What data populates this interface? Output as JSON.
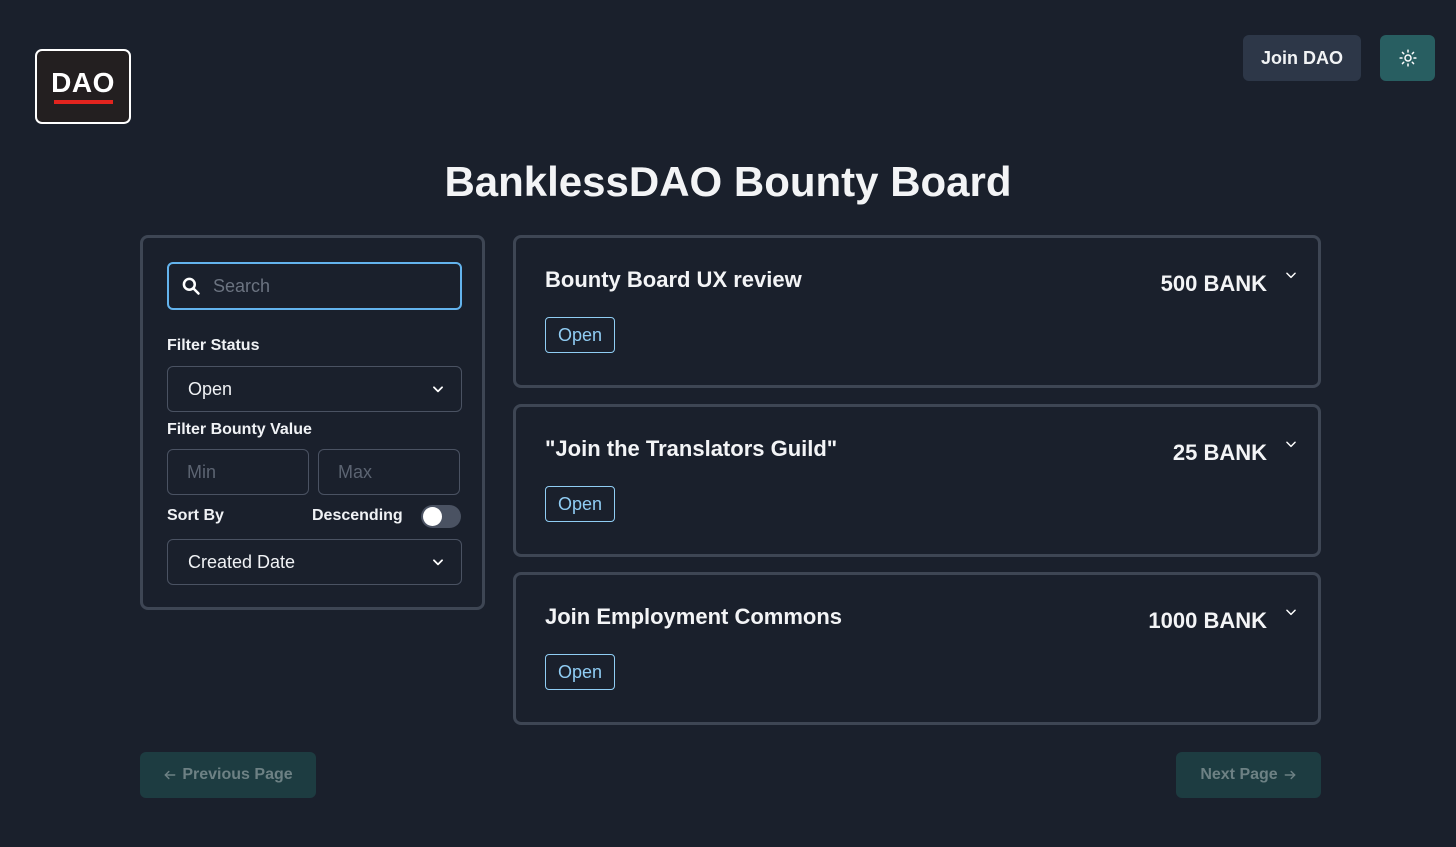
{
  "logo": {
    "text": "DAO"
  },
  "header": {
    "join_label": "Join DAO",
    "theme_toggle_icon": "sun-icon"
  },
  "page": {
    "title": "BanklessDAO Bounty Board"
  },
  "filters": {
    "search_placeholder": "Search",
    "status_label": "Filter Status",
    "status_value": "Open",
    "value_label": "Filter Bounty Value",
    "min_placeholder": "Min",
    "max_placeholder": "Max",
    "sort_label": "Sort By",
    "descending_label": "Descending",
    "descending_on": false,
    "sort_value": "Created Date"
  },
  "bounties": [
    {
      "title": "Bounty Board UX review",
      "amount": "500 BANK",
      "status": "Open"
    },
    {
      "title": "\"Join the Translators Guild\"",
      "amount": "25 BANK",
      "status": "Open"
    },
    {
      "title": "Join Employment Commons",
      "amount": "1000 BANK",
      "status": "Open"
    }
  ],
  "pagination": {
    "prev_label": "Previous Page",
    "next_label": "Next Page"
  },
  "colors": {
    "background": "#1a202c",
    "accent": "#285e61",
    "badge": "#90cdf4",
    "search_focus": "#63b3ed"
  }
}
